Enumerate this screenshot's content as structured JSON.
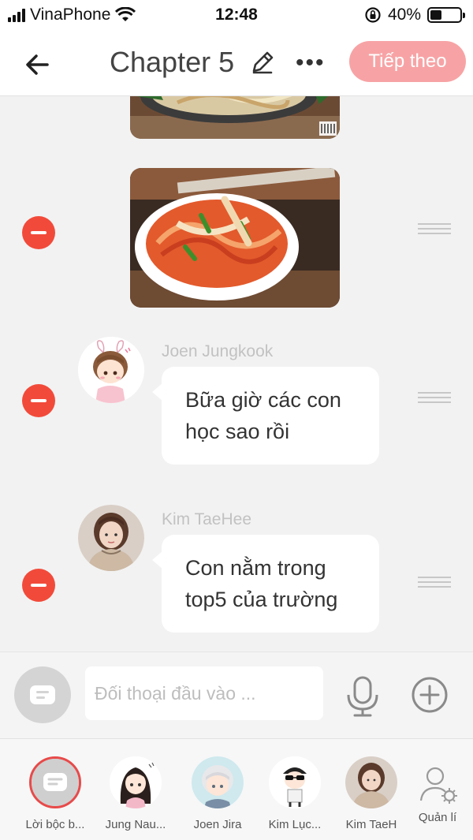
{
  "status_bar": {
    "carrier": "VinaPhone",
    "time": "12:48",
    "battery_percent": "40%",
    "battery_level": 0.4
  },
  "header": {
    "title": "Chapter 5",
    "next_label": "Tiếp theo",
    "more_label": "•••"
  },
  "messages": [
    {
      "speaker": "Joen Jungkook",
      "text": "Bữa giờ các con học sao rồi"
    },
    {
      "speaker": "Kim TaeHee",
      "text": "Con nằm trong top5 của trường"
    }
  ],
  "input": {
    "placeholder": "Đối thoại đầu vào ..."
  },
  "characters": [
    {
      "name": "Lời bộc b..."
    },
    {
      "name": "Jung Nau..."
    },
    {
      "name": "Joen Jira"
    },
    {
      "name": "Kim Lục..."
    },
    {
      "name": "Kim TaeH"
    }
  ],
  "manage_label": "Quản lí",
  "colors": {
    "accent": "#f7a3a5",
    "delete": "#f24a3a",
    "active_ring": "#e84a4a"
  }
}
